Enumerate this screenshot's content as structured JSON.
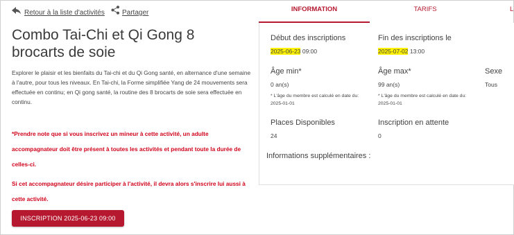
{
  "nav": {
    "back_label": "Retour à la liste d'activités",
    "share_label": "Partager"
  },
  "activity": {
    "title": "Combo Tai-Chi et Qi Gong 8 brocarts de soie",
    "description": "Explorer le plaisir et les bienfaits du Tai-chi et du Qi Gong santé, en alternance d'une semaine à l'autre, pour tous les niveaux. En Tai-chi, la Forme simplifiée Yang de 24 mouvements sera effectuée en continu; en Qi gong santé, la routine des 8 brocarts de soie sera effectuée en continu.",
    "warning_1": "*Prendre note que si vous inscrivez un mineur à cette activité, un adulte accompagnateur doit être présent à toutes les activités et pendant toute la durée de celles-ci.",
    "warning_2": "Si cet accompagnateur désire participer à l'activité, il devra alors s'inscrire lui aussi à cette activité.",
    "signup_button": "INSCRIPTION 2025-06-23 09:00"
  },
  "tabs": {
    "information": "INFORMATION",
    "tarifs": "TARIFS",
    "more": "L"
  },
  "info": {
    "debut_label": "Début des inscriptions",
    "debut_date": "2025-06-23",
    "debut_time": " 09:00",
    "fin_label": "Fin des inscriptions le",
    "fin_date": "2025-07-02",
    "fin_time": " 13:00",
    "age_min_label": "Âge min*",
    "age_min_value": "0 an(s)",
    "age_min_note": "* L'âge du membre est calculé en date du: 2025-01-01",
    "age_max_label": "Âge max*",
    "age_max_value": "99 an(s)",
    "age_max_note": "* L'âge du membre est calculé en date du: 2025-01-01",
    "sexe_label": "Sexe",
    "sexe_value": "Tous",
    "places_label": "Places Disponibles",
    "places_value": "24",
    "attente_label": "Inscription en attente",
    "attente_value": "0",
    "extra_label": "Informations supplémentaires :"
  },
  "colors": {
    "accent": "#b5182f",
    "warning": "#d0021b",
    "highlight": "#fff200"
  }
}
